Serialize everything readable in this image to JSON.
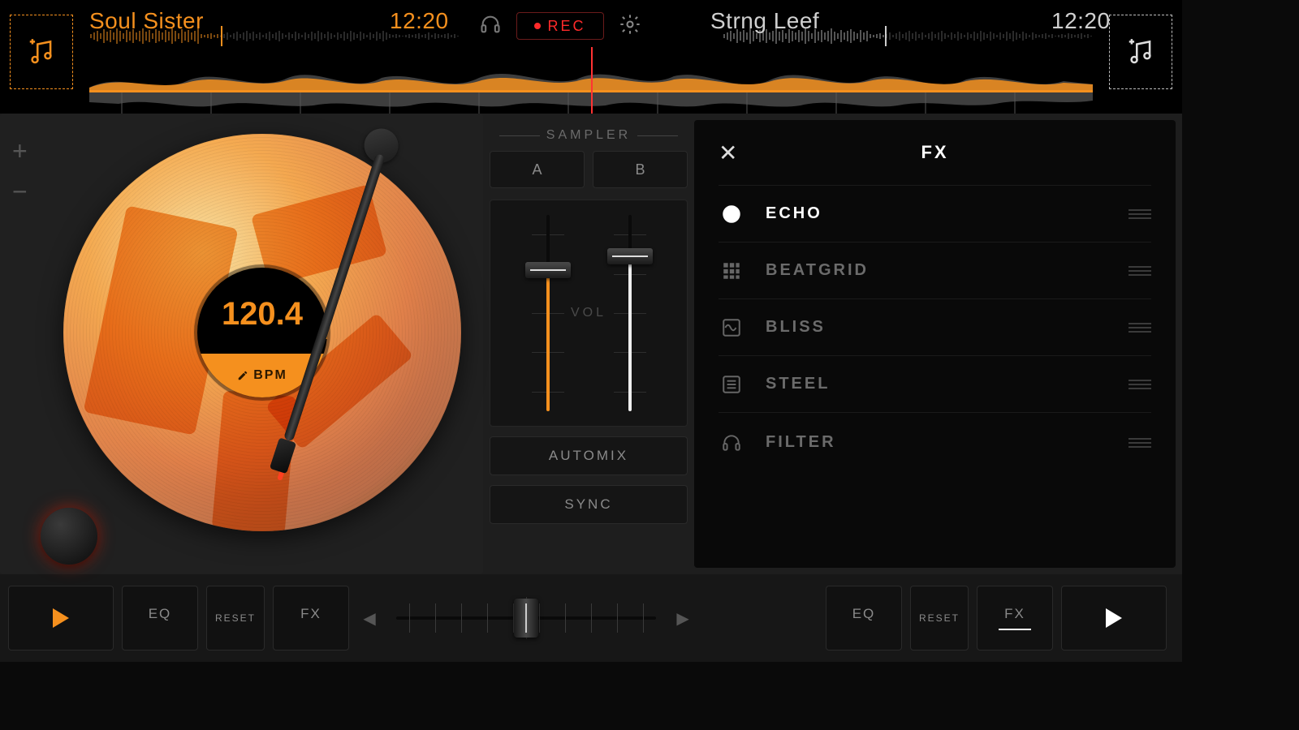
{
  "deckA": {
    "title": "Soul Sister",
    "time": "12:20",
    "bpm": "120.4",
    "bpm_label": "BPM"
  },
  "deckB": {
    "title": "Strng Leef",
    "time": "12:20"
  },
  "rec_label": "REC",
  "sampler": {
    "label": "SAMPLER",
    "a": "A",
    "b": "B"
  },
  "mixer": {
    "vol": "VOL",
    "automix": "AUTOMIX",
    "sync": "SYNC"
  },
  "fx": {
    "title": "FX",
    "items": [
      {
        "name": "ECHO",
        "icon": "spiral",
        "active": true
      },
      {
        "name": "BEATGRID",
        "icon": "grid",
        "active": false
      },
      {
        "name": "BLISS",
        "icon": "wave",
        "active": false
      },
      {
        "name": "STEEL",
        "icon": "lines",
        "active": false
      },
      {
        "name": "FILTER",
        "icon": "headphones",
        "active": false
      }
    ]
  },
  "bottom": {
    "eq": "EQ",
    "reset": "RESET",
    "fx": "FX"
  }
}
